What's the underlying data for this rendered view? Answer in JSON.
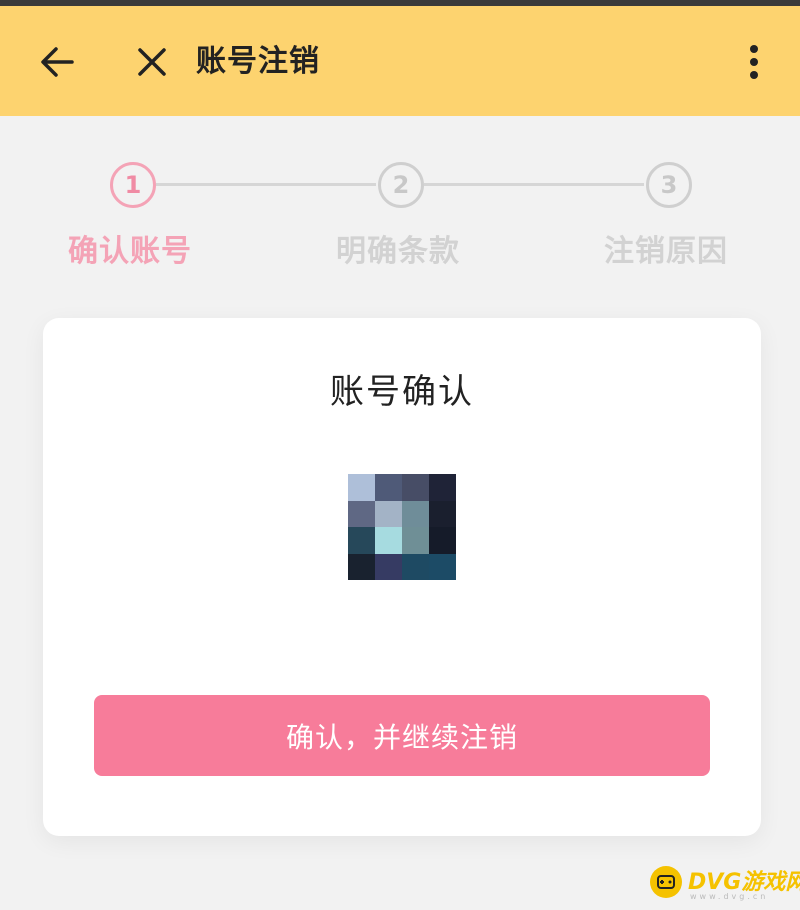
{
  "header": {
    "title": "账号注销",
    "back_icon": "arrow-left-icon",
    "close_icon": "close-icon",
    "more_icon": "more-vertical-icon",
    "background": "#fdd36f"
  },
  "steps": [
    {
      "number": "1",
      "label": "确认账号",
      "active": true
    },
    {
      "number": "2",
      "label": "明确条款",
      "active": false
    },
    {
      "number": "3",
      "label": "注销原因",
      "active": false
    }
  ],
  "accent_color": "#f77c9a",
  "card": {
    "title": "账号确认",
    "avatar_icon": "user-avatar-pixelated",
    "confirm_button": "确认，并继续注销"
  },
  "watermark": {
    "brand": "DVG游戏网",
    "sub": "www.dvg.cn"
  }
}
